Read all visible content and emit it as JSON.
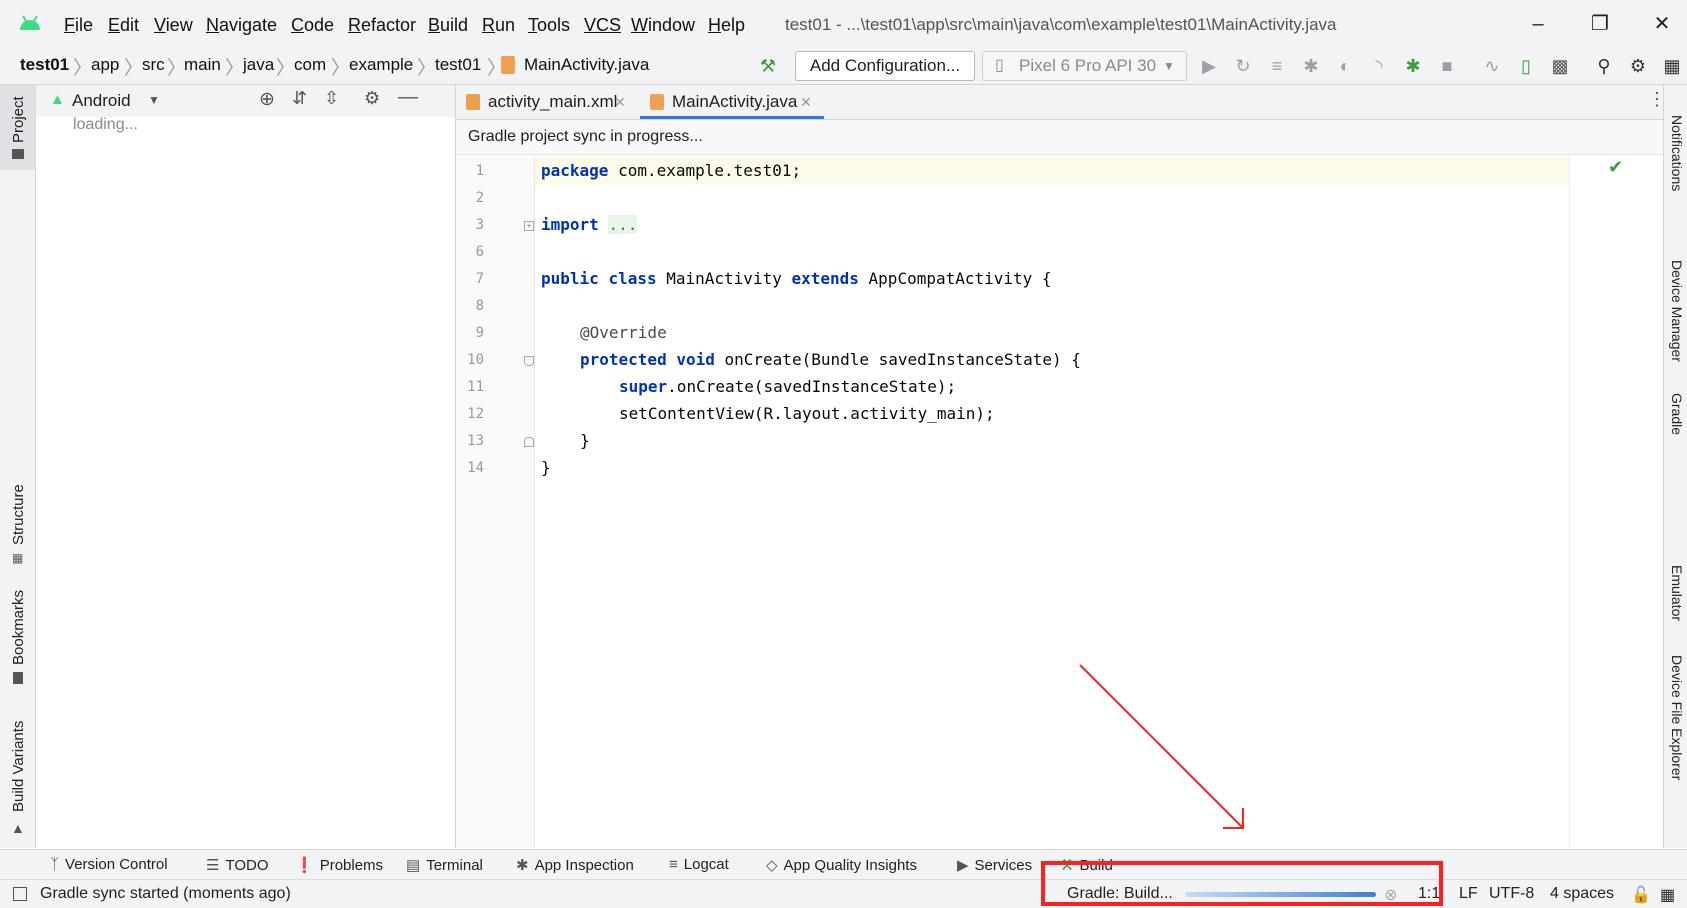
{
  "menu": {
    "items": [
      {
        "key": "F",
        "rest": "ile"
      },
      {
        "key": "E",
        "rest": "dit"
      },
      {
        "key": "V",
        "rest": "iew"
      },
      {
        "key": "N",
        "rest": "avigate"
      },
      {
        "key": "C",
        "rest": "ode"
      },
      {
        "key": "R",
        "rest": "efactor"
      },
      {
        "key": "B",
        "rest": "uild"
      },
      {
        "key": "R",
        "rest": "un"
      },
      {
        "key": "T",
        "rest": "ools"
      },
      {
        "key": "VCS",
        "rest": ""
      },
      {
        "key": "W",
        "rest": "indow"
      },
      {
        "key": "H",
        "rest": "elp"
      }
    ]
  },
  "window": {
    "title": "test01 - ...\\test01\\app\\src\\main\\java\\com\\example\\test01\\MainActivity.java"
  },
  "breadcrumb": [
    "test01",
    "app",
    "src",
    "main",
    "java",
    "com",
    "example",
    "test01",
    "MainActivity.java"
  ],
  "toolbar": {
    "run_config": "Add Configuration...",
    "device": "Pixel 6 Pro API 30"
  },
  "project": {
    "view": "Android",
    "loading": "loading..."
  },
  "left_tabs": [
    "Project",
    "Structure",
    "Bookmarks",
    "Build Variants"
  ],
  "right_tabs": [
    "Notifications",
    "Device Manager",
    "Gradle",
    "Emulator",
    "Device File Explorer"
  ],
  "editor": {
    "tabs": [
      {
        "label": "activity_main.xml",
        "active": false
      },
      {
        "label": "MainActivity.java",
        "active": true
      }
    ],
    "sync_banner": "Gradle project sync in progress...",
    "line_numbers": [
      "1",
      "2",
      "3",
      "6",
      "7",
      "8",
      "9",
      "10",
      "11",
      "12",
      "13",
      "14"
    ],
    "code": {
      "l1_kw": "package",
      "l1_rest": " com.example.test01;",
      "l3_kw": "import",
      "l3_fold": "...",
      "l7_kw1": "public",
      "l7_kw2": "class",
      "l7_mid": " MainActivity ",
      "l7_kw3": "extends",
      "l7_rest": " AppCompatActivity {",
      "l9_ann": "@Override",
      "l10_kw1": "protected",
      "l10_kw2": "void",
      "l10_rest": " onCreate(Bundle savedInstanceState) {",
      "l11_kw": "super",
      "l11_rest": ".onCreate(savedInstanceState);",
      "l12": "setContentView(R.layout.activity_main);",
      "l13": "}",
      "l14": "}"
    }
  },
  "bottom_tools": [
    "Version Control",
    "TODO",
    "Problems",
    "Terminal",
    "App Inspection",
    "Logcat",
    "App Quality Insights",
    "Services",
    "Build"
  ],
  "status": {
    "message": "Gradle sync started (moments ago)",
    "task": "Gradle: Build...",
    "position": "1:1",
    "line_sep": "LF",
    "encoding": "UTF-8",
    "indent": "4 spaces"
  },
  "colors": {
    "keyword": "#0033b3",
    "annotation_arrow": "#ff1f1f",
    "progress": "#3d7fd9",
    "check": "#3c9c3c"
  }
}
